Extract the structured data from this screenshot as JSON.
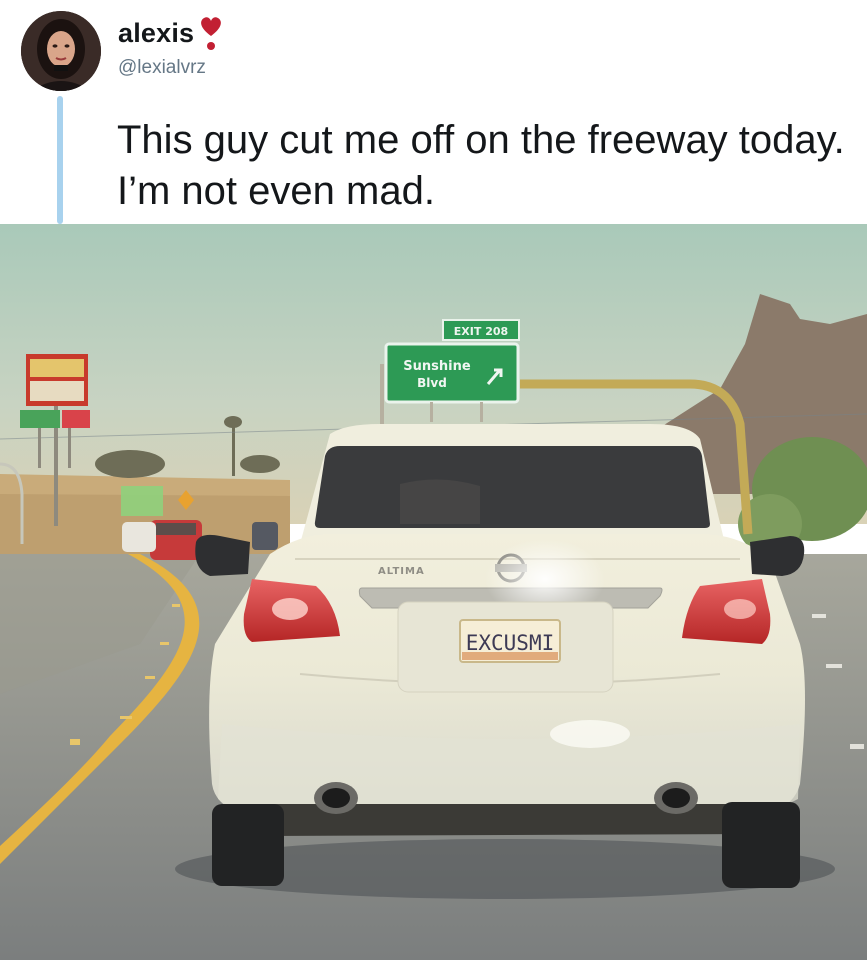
{
  "tweet": {
    "display_name": "alexis",
    "handle": "@lexialvrz",
    "text": "This guy cut me off on the freeway today. I’m not even mad.",
    "name_emoji_icon": "heavy-heart-exclamation-icon"
  },
  "photo": {
    "road_sign_line1": "Sunshine",
    "road_sign_line2": "Blvd",
    "exit_tab": "EXIT 208",
    "car_badge": "ALTIMA",
    "license_plate": "EXCUSMI"
  },
  "colors": {
    "accent_thread_line": "#a8d2ee",
    "text_primary": "#14171a",
    "text_secondary": "#657786",
    "heart": "#c22033"
  }
}
